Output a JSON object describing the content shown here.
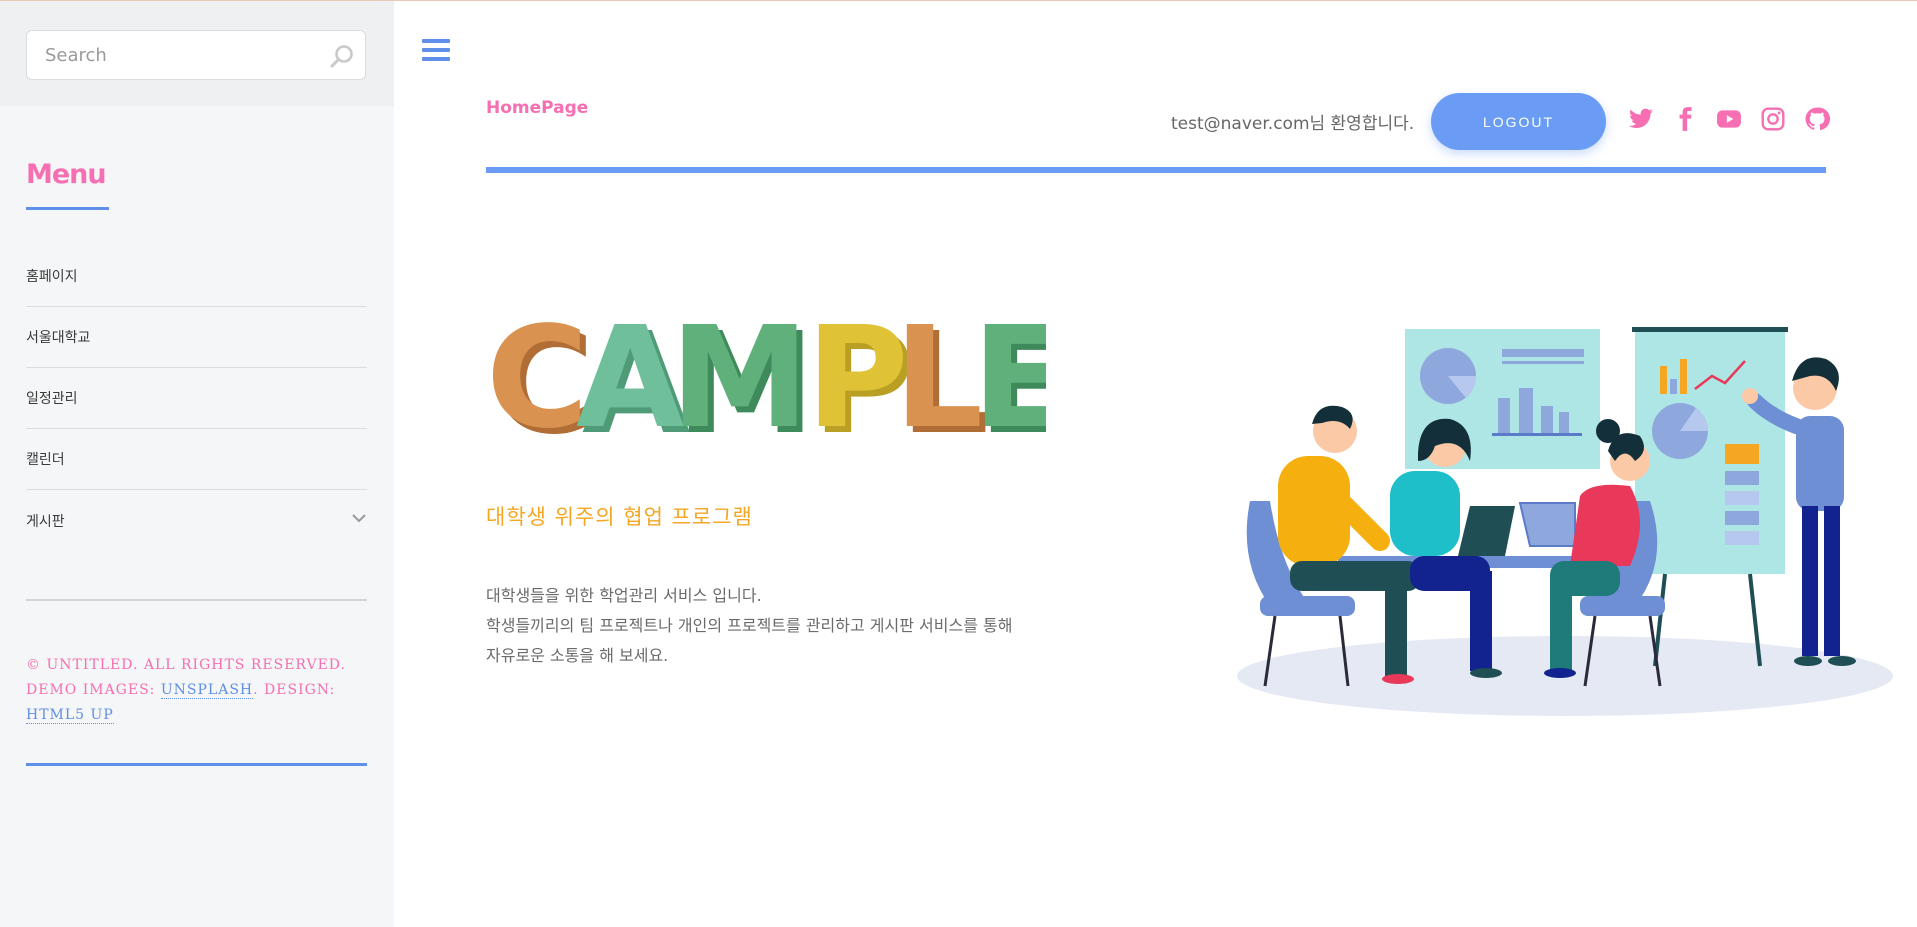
{
  "sidebar": {
    "search_placeholder": "Search",
    "menu_title": "Menu",
    "items": [
      {
        "label": "홈페이지"
      },
      {
        "label": "서울대학교"
      },
      {
        "label": "일정관리"
      },
      {
        "label": "캘린더"
      },
      {
        "label": "게시판",
        "has_submenu": true
      }
    ],
    "footer": {
      "copyright": "© UNTITLED. ALL RIGHTS RESERVED.",
      "demo_prefix": "DEMO IMAGES:",
      "unsplash": "UNSPLASH",
      "design_prefix": ". DESIGN:",
      "html5up": "HTML5 UP"
    }
  },
  "header": {
    "homepage": "HomePage",
    "welcome": "test@naver.com님 환영합니다.",
    "logout_label": "LOGOUT",
    "social_icons": [
      "twitter-icon",
      "facebook-icon",
      "youtube-icon",
      "instagram-icon",
      "github-icon"
    ]
  },
  "hero": {
    "logo_text": "CAMPLE",
    "tagline": "대학생 위주의 협업 프로그램",
    "description_lines": [
      "대학생들을 위한 학업관리 서비스 입니다.",
      "학생들끼리의 팀 프로젝트나 개인의 프로젝트를 관리하고 게시판 서비스를 통해",
      "자유로운 소통을 해 보세요."
    ]
  },
  "colors": {
    "accent_blue": "#6a9cf5",
    "accent_pink": "#f56fb2",
    "tagline_orange": "#f5a623",
    "logo_letters": [
      "#d9924f",
      "#6fbf9a",
      "#5fb07a",
      "#e0c236",
      "#d9924f",
      "#5fb07a"
    ]
  }
}
